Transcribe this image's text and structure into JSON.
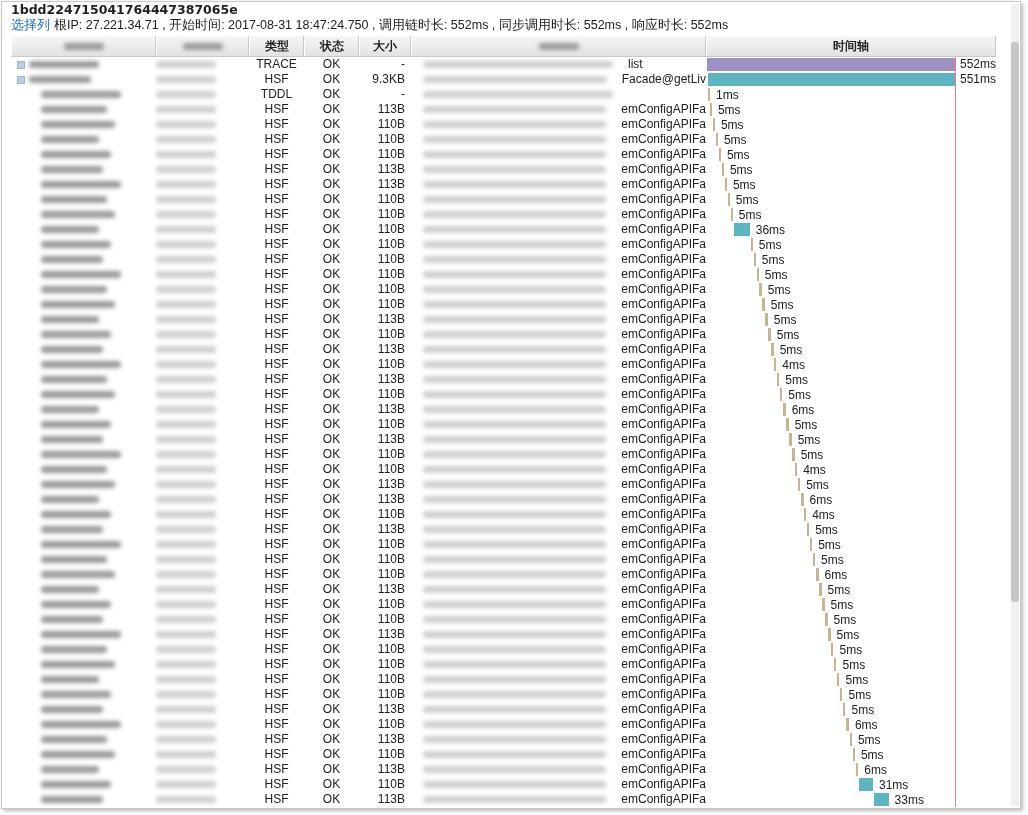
{
  "trace_id": "1bdd224715041764447387065e",
  "select_columns_link": "选择列",
  "summary": "根IP: 27.221.34.71 , 开始时间: 2017-08-31 18:47:24.750 , 调用链时长: 552ms , 同步调用时长: 552ms , 响应时长: 552ms",
  "table": {
    "columns": [
      {
        "kind": "blurred"
      },
      {
        "kind": "blurred"
      },
      {
        "kind": "text",
        "label": "类型"
      },
      {
        "kind": "text",
        "label": "状态"
      },
      {
        "kind": "text",
        "label": "大小"
      },
      {
        "kind": "blurred"
      },
      {
        "kind": "text",
        "label": "时间轴"
      }
    ],
    "rows": [
      {
        "type": "TRACE",
        "status": "OK",
        "size": "-",
        "service_tail": "list",
        "duration": "552ms",
        "kind": "trace",
        "expandable": true
      },
      {
        "type": "HSF",
        "status": "OK",
        "size": "9.3KB",
        "service_tail": "Facade@getLiv",
        "duration": "551ms",
        "kind": "call",
        "expandable": true
      },
      {
        "type": "TDDL",
        "status": "OK",
        "size": "-",
        "duration": "1ms",
        "kind": "call",
        "expandable": false
      },
      {
        "type": "HSF",
        "status": "OK",
        "size": "113B",
        "service_tail": "emConfigAPIFa",
        "duration": "5ms",
        "kind": "call",
        "expandable": false
      },
      {
        "type": "HSF",
        "status": "OK",
        "size": "110B",
        "service_tail": "emConfigAPIFa",
        "duration": "5ms",
        "kind": "call",
        "expandable": false
      },
      {
        "type": "HSF",
        "status": "OK",
        "size": "110B",
        "service_tail": "emConfigAPIFa",
        "duration": "5ms",
        "kind": "call",
        "expandable": false
      },
      {
        "type": "HSF",
        "status": "OK",
        "size": "110B",
        "service_tail": "emConfigAPIFa",
        "duration": "5ms",
        "kind": "call",
        "expandable": false
      },
      {
        "type": "HSF",
        "status": "OK",
        "size": "113B",
        "service_tail": "emConfigAPIFa",
        "duration": "5ms",
        "kind": "call",
        "expandable": false
      },
      {
        "type": "HSF",
        "status": "OK",
        "size": "113B",
        "service_tail": "emConfigAPIFa",
        "duration": "5ms",
        "kind": "call",
        "expandable": false
      },
      {
        "type": "HSF",
        "status": "OK",
        "size": "110B",
        "service_tail": "emConfigAPIFa",
        "duration": "5ms",
        "kind": "call",
        "expandable": false
      },
      {
        "type": "HSF",
        "status": "OK",
        "size": "110B",
        "service_tail": "emConfigAPIFa",
        "duration": "5ms",
        "kind": "call",
        "expandable": false
      },
      {
        "type": "HSF",
        "status": "OK",
        "size": "110B",
        "service_tail": "emConfigAPIFa",
        "duration": "36ms",
        "kind": "call",
        "expandable": false
      },
      {
        "type": "HSF",
        "status": "OK",
        "size": "110B",
        "service_tail": "emConfigAPIFa",
        "duration": "5ms",
        "kind": "call",
        "expandable": false
      },
      {
        "type": "HSF",
        "status": "OK",
        "size": "110B",
        "service_tail": "emConfigAPIFa",
        "duration": "5ms",
        "kind": "call",
        "expandable": false
      },
      {
        "type": "HSF",
        "status": "OK",
        "size": "110B",
        "service_tail": "emConfigAPIFa",
        "duration": "5ms",
        "kind": "call",
        "expandable": false
      },
      {
        "type": "HSF",
        "status": "OK",
        "size": "110B",
        "service_tail": "emConfigAPIFa",
        "duration": "5ms",
        "kind": "call",
        "expandable": false
      },
      {
        "type": "HSF",
        "status": "OK",
        "size": "110B",
        "service_tail": "emConfigAPIFa",
        "duration": "5ms",
        "kind": "call",
        "expandable": false
      },
      {
        "type": "HSF",
        "status": "OK",
        "size": "113B",
        "service_tail": "emConfigAPIFa",
        "duration": "5ms",
        "kind": "call",
        "expandable": false
      },
      {
        "type": "HSF",
        "status": "OK",
        "size": "110B",
        "service_tail": "emConfigAPIFa",
        "duration": "5ms",
        "kind": "call",
        "expandable": false
      },
      {
        "type": "HSF",
        "status": "OK",
        "size": "113B",
        "service_tail": "emConfigAPIFa",
        "duration": "5ms",
        "kind": "call",
        "expandable": false
      },
      {
        "type": "HSF",
        "status": "OK",
        "size": "110B",
        "service_tail": "emConfigAPIFa",
        "duration": "4ms",
        "kind": "call",
        "expandable": false
      },
      {
        "type": "HSF",
        "status": "OK",
        "size": "113B",
        "service_tail": "emConfigAPIFa",
        "duration": "5ms",
        "kind": "call",
        "expandable": false
      },
      {
        "type": "HSF",
        "status": "OK",
        "size": "110B",
        "service_tail": "emConfigAPIFa",
        "duration": "5ms",
        "kind": "call",
        "expandable": false
      },
      {
        "type": "HSF",
        "status": "OK",
        "size": "113B",
        "service_tail": "emConfigAPIFa",
        "duration": "6ms",
        "kind": "call",
        "expandable": false
      },
      {
        "type": "HSF",
        "status": "OK",
        "size": "110B",
        "service_tail": "emConfigAPIFa",
        "duration": "5ms",
        "kind": "call",
        "expandable": false
      },
      {
        "type": "HSF",
        "status": "OK",
        "size": "113B",
        "service_tail": "emConfigAPIFa",
        "duration": "5ms",
        "kind": "call",
        "expandable": false
      },
      {
        "type": "HSF",
        "status": "OK",
        "size": "110B",
        "service_tail": "emConfigAPIFa",
        "duration": "5ms",
        "kind": "call",
        "expandable": false
      },
      {
        "type": "HSF",
        "status": "OK",
        "size": "110B",
        "service_tail": "emConfigAPIFa",
        "duration": "4ms",
        "kind": "call",
        "expandable": false
      },
      {
        "type": "HSF",
        "status": "OK",
        "size": "113B",
        "service_tail": "emConfigAPIFa",
        "duration": "5ms",
        "kind": "call",
        "expandable": false
      },
      {
        "type": "HSF",
        "status": "OK",
        "size": "113B",
        "service_tail": "emConfigAPIFa",
        "duration": "6ms",
        "kind": "call",
        "expandable": false
      },
      {
        "type": "HSF",
        "status": "OK",
        "size": "110B",
        "service_tail": "emConfigAPIFa",
        "duration": "4ms",
        "kind": "call",
        "expandable": false
      },
      {
        "type": "HSF",
        "status": "OK",
        "size": "113B",
        "service_tail": "emConfigAPIFa",
        "duration": "5ms",
        "kind": "call",
        "expandable": false
      },
      {
        "type": "HSF",
        "status": "OK",
        "size": "110B",
        "service_tail": "emConfigAPIFa",
        "duration": "5ms",
        "kind": "call",
        "expandable": false
      },
      {
        "type": "HSF",
        "status": "OK",
        "size": "110B",
        "service_tail": "emConfigAPIFa",
        "duration": "5ms",
        "kind": "call",
        "expandable": false
      },
      {
        "type": "HSF",
        "status": "OK",
        "size": "110B",
        "service_tail": "emConfigAPIFa",
        "duration": "6ms",
        "kind": "call",
        "expandable": false
      },
      {
        "type": "HSF",
        "status": "OK",
        "size": "113B",
        "service_tail": "emConfigAPIFa",
        "duration": "5ms",
        "kind": "call",
        "expandable": false
      },
      {
        "type": "HSF",
        "status": "OK",
        "size": "110B",
        "service_tail": "emConfigAPIFa",
        "duration": "5ms",
        "kind": "call",
        "expandable": false
      },
      {
        "type": "HSF",
        "status": "OK",
        "size": "110B",
        "service_tail": "emConfigAPIFa",
        "duration": "5ms",
        "kind": "call",
        "expandable": false
      },
      {
        "type": "HSF",
        "status": "OK",
        "size": "113B",
        "service_tail": "emConfigAPIFa",
        "duration": "5ms",
        "kind": "call",
        "expandable": false
      },
      {
        "type": "HSF",
        "status": "OK",
        "size": "110B",
        "service_tail": "emConfigAPIFa",
        "duration": "5ms",
        "kind": "call",
        "expandable": false
      },
      {
        "type": "HSF",
        "status": "OK",
        "size": "110B",
        "service_tail": "emConfigAPIFa",
        "duration": "5ms",
        "kind": "call",
        "expandable": false
      },
      {
        "type": "HSF",
        "status": "OK",
        "size": "110B",
        "service_tail": "emConfigAPIFa",
        "duration": "5ms",
        "kind": "call",
        "expandable": false
      },
      {
        "type": "HSF",
        "status": "OK",
        "size": "110B",
        "service_tail": "emConfigAPIFa",
        "duration": "5ms",
        "kind": "call",
        "expandable": false
      },
      {
        "type": "HSF",
        "status": "OK",
        "size": "113B",
        "service_tail": "emConfigAPIFa",
        "duration": "5ms",
        "kind": "call",
        "expandable": false
      },
      {
        "type": "HSF",
        "status": "OK",
        "size": "110B",
        "service_tail": "emConfigAPIFa",
        "duration": "6ms",
        "kind": "call",
        "expandable": false
      },
      {
        "type": "HSF",
        "status": "OK",
        "size": "113B",
        "service_tail": "emConfigAPIFa",
        "duration": "5ms",
        "kind": "call",
        "expandable": false
      },
      {
        "type": "HSF",
        "status": "OK",
        "size": "110B",
        "service_tail": "emConfigAPIFa",
        "duration": "5ms",
        "kind": "call",
        "expandable": false
      },
      {
        "type": "HSF",
        "status": "OK",
        "size": "113B",
        "service_tail": "emConfigAPIFa",
        "duration": "6ms",
        "kind": "call",
        "expandable": false
      },
      {
        "type": "HSF",
        "status": "OK",
        "size": "110B",
        "service_tail": "emConfigAPIFa",
        "duration": "31ms",
        "kind": "call",
        "expandable": false
      },
      {
        "type": "HSF",
        "status": "OK",
        "size": "113B",
        "service_tail": "emConfigAPIFa",
        "duration": "33ms",
        "kind": "call",
        "expandable": false
      }
    ]
  }
}
